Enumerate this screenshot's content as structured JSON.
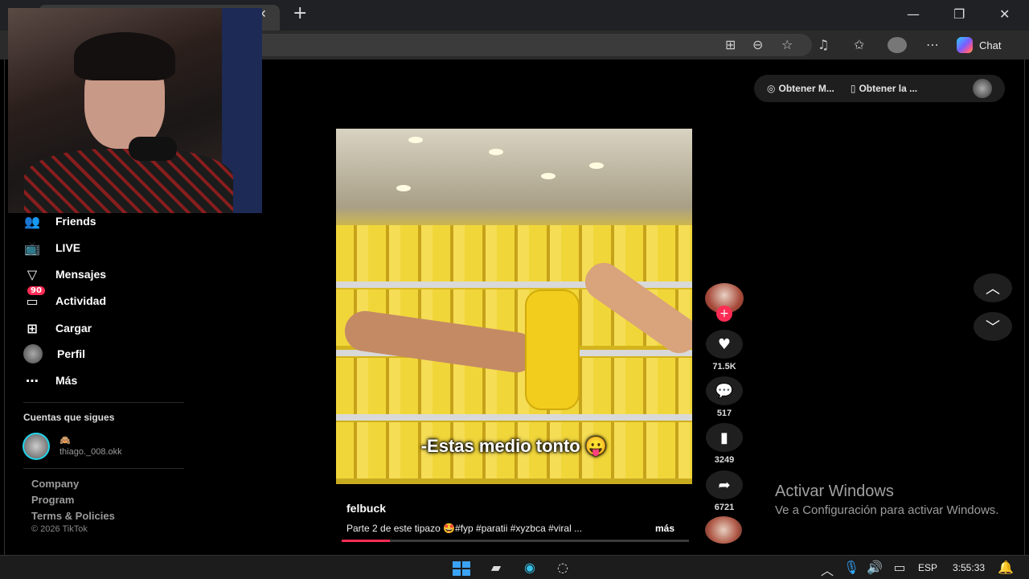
{
  "browser": {
    "tab_close": "✕",
    "new_tab": "+",
    "win_min": "—",
    "win_restore": "❐",
    "win_close": "✕",
    "chat_label": "Chat"
  },
  "sidebar": {
    "items": [
      {
        "label": "Friends",
        "icon": "friends-icon"
      },
      {
        "label": "LIVE",
        "icon": "live-icon"
      },
      {
        "label": "Mensajes",
        "icon": "messages-icon"
      },
      {
        "label": "Actividad",
        "icon": "activity-icon",
        "badge": "90"
      },
      {
        "label": "Cargar",
        "icon": "upload-icon"
      },
      {
        "label": "Perfil",
        "icon": "profile-avatar"
      },
      {
        "label": "Más",
        "icon": "more-icon"
      }
    ],
    "following_title": "Cuentas que sigues",
    "following": [
      {
        "line1": "🙈",
        "line2": "thiago._008.okk"
      }
    ],
    "footer": [
      "Company",
      "Program",
      "Terms & Policies"
    ],
    "copyright": "© 2026 TikTok"
  },
  "top_actions": {
    "item1": "Obtener M...",
    "item2": "Obtener la ..."
  },
  "video": {
    "caption": "-Estas medio tonto 😛",
    "author": "felbuck",
    "description": "Parte 2 de este tipazo 🤩#fyp #paratii #xyzbca #viral ...",
    "more": "más",
    "progress": 0.14
  },
  "actions": {
    "likes": "71.5K",
    "comments": "517",
    "saves": "3249",
    "shares": "6721"
  },
  "watermark": {
    "title": "Activar Windows",
    "subtitle": "Ve a Configuración para activar Windows."
  },
  "taskbar": {
    "lang": "ESP",
    "time": "3:55:33"
  },
  "colors": {
    "accent": "#fe2c55",
    "following_ring": "#20d5ec"
  }
}
